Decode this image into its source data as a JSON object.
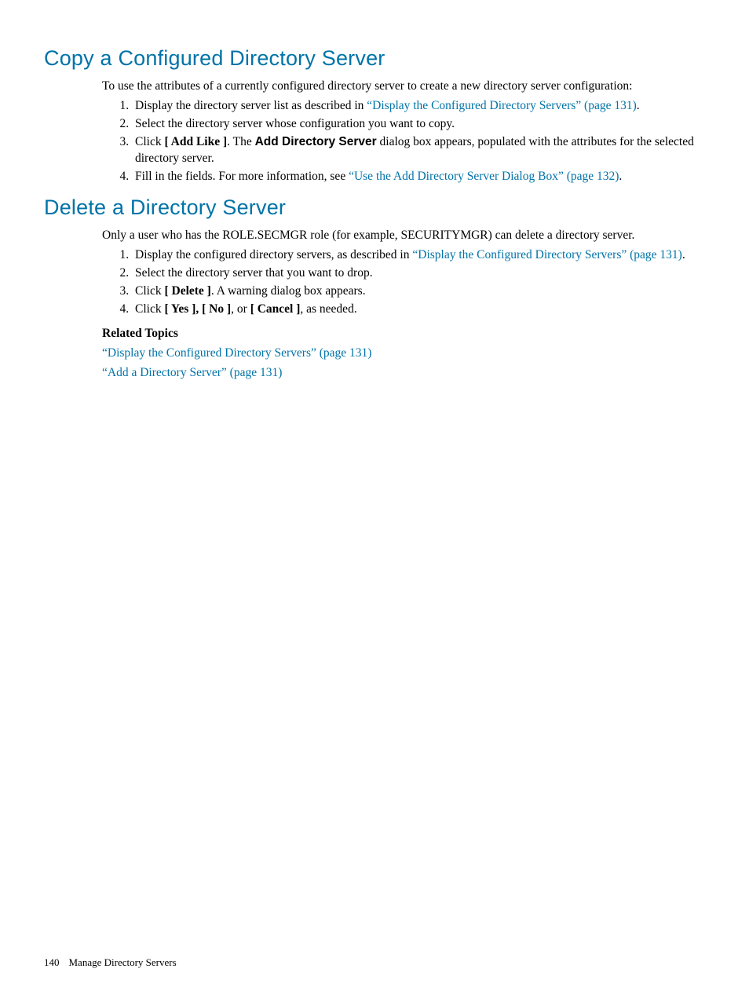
{
  "section1": {
    "heading": "Copy a Configured Directory Server",
    "intro": "To use the attributes of a currently configured directory server to create a new directory server configuration:",
    "steps": {
      "s1_pre": "Display the directory server list as described in ",
      "s1_link": "“Display the Configured Directory Servers” (page 131)",
      "s1_post": ".",
      "s2": "Select the directory server whose configuration you want to copy.",
      "s3_pre": "Click ",
      "s3_btn": "[ Add Like ]",
      "s3_mid": ". The ",
      "s3_dialog": "Add Directory Server",
      "s3_post": " dialog box appears, populated with the attributes for the selected directory server.",
      "s4_pre": "Fill in the fields. For more information, see ",
      "s4_link": "“Use the Add Directory Server Dialog Box” (page 132)",
      "s4_post": "."
    }
  },
  "section2": {
    "heading": "Delete a Directory Server",
    "intro": "Only a user who has the ROLE.SECMGR role (for example, SECURITYMGR) can delete a directory server.",
    "steps": {
      "s1_pre": "Display the configured directory servers, as described in ",
      "s1_link": "“Display the Configured Directory Servers” (page 131)",
      "s1_post": ".",
      "s2": "Select the directory server that you want to drop.",
      "s3_pre": "Click ",
      "s3_btn": "[ Delete ]",
      "s3_post": ". A warning dialog box appears.",
      "s4_pre": "Click ",
      "s4_yes": "[ Yes ],",
      "s4_no": " [ No ]",
      "s4_mid": ", or ",
      "s4_cancel": "[ Cancel ]",
      "s4_post": ", as needed."
    },
    "related": {
      "heading": "Related Topics",
      "link1": "“Display the Configured Directory Servers” (page 131)",
      "link2": "“Add a Directory Server” (page 131)"
    }
  },
  "footer": {
    "page_number": "140",
    "chapter": "Manage Directory Servers"
  }
}
